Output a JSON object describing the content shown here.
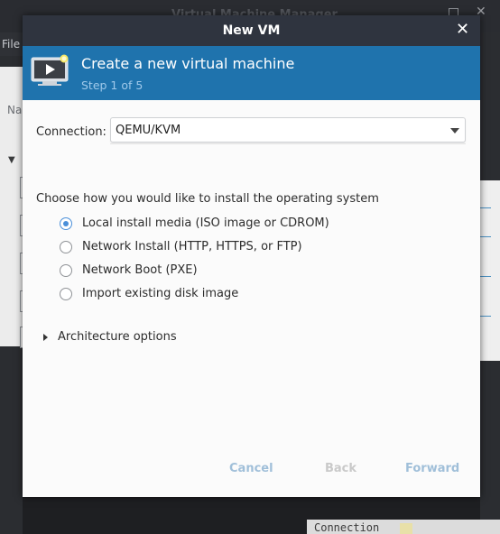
{
  "background": {
    "window_title": "Virtual Machine Manager",
    "menu_file": "File",
    "list_header_partial": "Na",
    "bottom_text": "Connection"
  },
  "dialog": {
    "title": "New VM",
    "close_glyph": "✕",
    "banner": {
      "title": "Create a new virtual machine",
      "step": "Step 1 of 5",
      "icon": "vm-monitor-icon"
    },
    "connection": {
      "label": "Connection:",
      "value": "QEMU/KVM"
    },
    "install": {
      "heading": "Choose how you would like to install the operating system",
      "options": [
        {
          "label": "Local install media (ISO image or CDROM)",
          "selected": true
        },
        {
          "label": "Network Install (HTTP, HTTPS, or FTP)",
          "selected": false
        },
        {
          "label": "Network Boot (PXE)",
          "selected": false
        },
        {
          "label": "Import existing disk image",
          "selected": false
        }
      ]
    },
    "architecture_options": "Architecture options",
    "buttons": {
      "cancel": "Cancel",
      "back": "Back",
      "forward": "Forward"
    }
  },
  "colors": {
    "banner": "#1f73ad",
    "titlebar": "#2f343f",
    "accent": "#4a8fd9"
  }
}
